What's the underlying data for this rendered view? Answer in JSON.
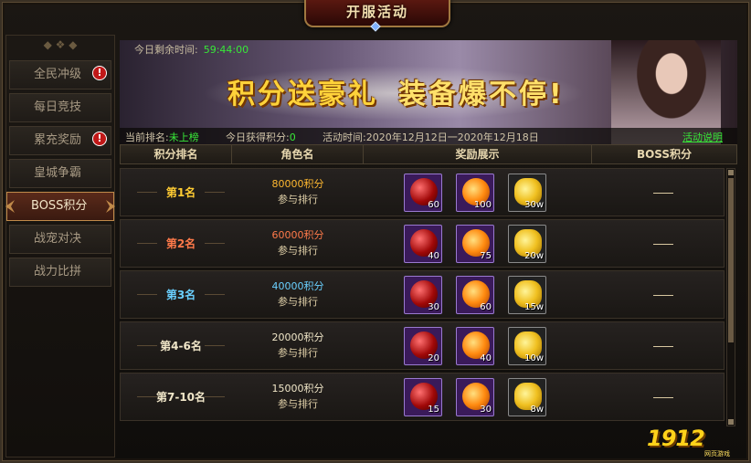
{
  "window": {
    "title": "开服活动"
  },
  "sidebar": {
    "items": [
      {
        "label": "全民冲级",
        "badge": "!"
      },
      {
        "label": "每日竞技",
        "badge": ""
      },
      {
        "label": "累充奖励",
        "badge": "!"
      },
      {
        "label": "皇城争霸",
        "badge": ""
      },
      {
        "label": "BOSS积分",
        "badge": ""
      },
      {
        "label": "战宠对决",
        "badge": ""
      },
      {
        "label": "战力比拼",
        "badge": ""
      }
    ],
    "active_index": 4
  },
  "header": {
    "timer_label": "今日剩余时间:",
    "timer_value": "59:44:00",
    "banner_text_1": "积分送豪礼",
    "banner_text_2": "装备爆不停!",
    "rank_label": "当前排名:",
    "rank_value": "未上榜",
    "points_label": "今日获得积分:",
    "points_value": "0",
    "time_label": "活动时间:",
    "time_value": "2020年12月12日一2020年12月18日",
    "help_link": "活动说明"
  },
  "table": {
    "headers": [
      "积分排名",
      "角色名",
      "奖励展示",
      "BOSS积分"
    ],
    "rows": [
      {
        "rank": "第1名",
        "points": "80000积分",
        "join": "参与排行",
        "rewards": [
          "60",
          "100",
          "30w"
        ],
        "boss": ""
      },
      {
        "rank": "第2名",
        "points": "60000积分",
        "join": "参与排行",
        "rewards": [
          "40",
          "75",
          "20w"
        ],
        "boss": ""
      },
      {
        "rank": "第3名",
        "points": "40000积分",
        "join": "参与排行",
        "rewards": [
          "30",
          "60",
          "15w"
        ],
        "boss": ""
      },
      {
        "rank": "第4-6名",
        "points": "20000积分",
        "join": "参与排行",
        "rewards": [
          "20",
          "40",
          "10w"
        ],
        "boss": ""
      },
      {
        "rank": "第7-10名",
        "points": "15000积分",
        "join": "参与排行",
        "rewards": [
          "15",
          "30",
          "8w"
        ],
        "boss": ""
      }
    ]
  },
  "branding": {
    "logo": "1912",
    "sub": "网页游戏"
  },
  "colors": {
    "accent_gold": "#ffcc33",
    "green": "#38e838",
    "active_border": "#c08a4a"
  },
  "icons": [
    "red-orb-icon",
    "orange-wing-orb-icon",
    "gold-coins-icon",
    "scroll-up-icon",
    "scroll-down-icon"
  ]
}
